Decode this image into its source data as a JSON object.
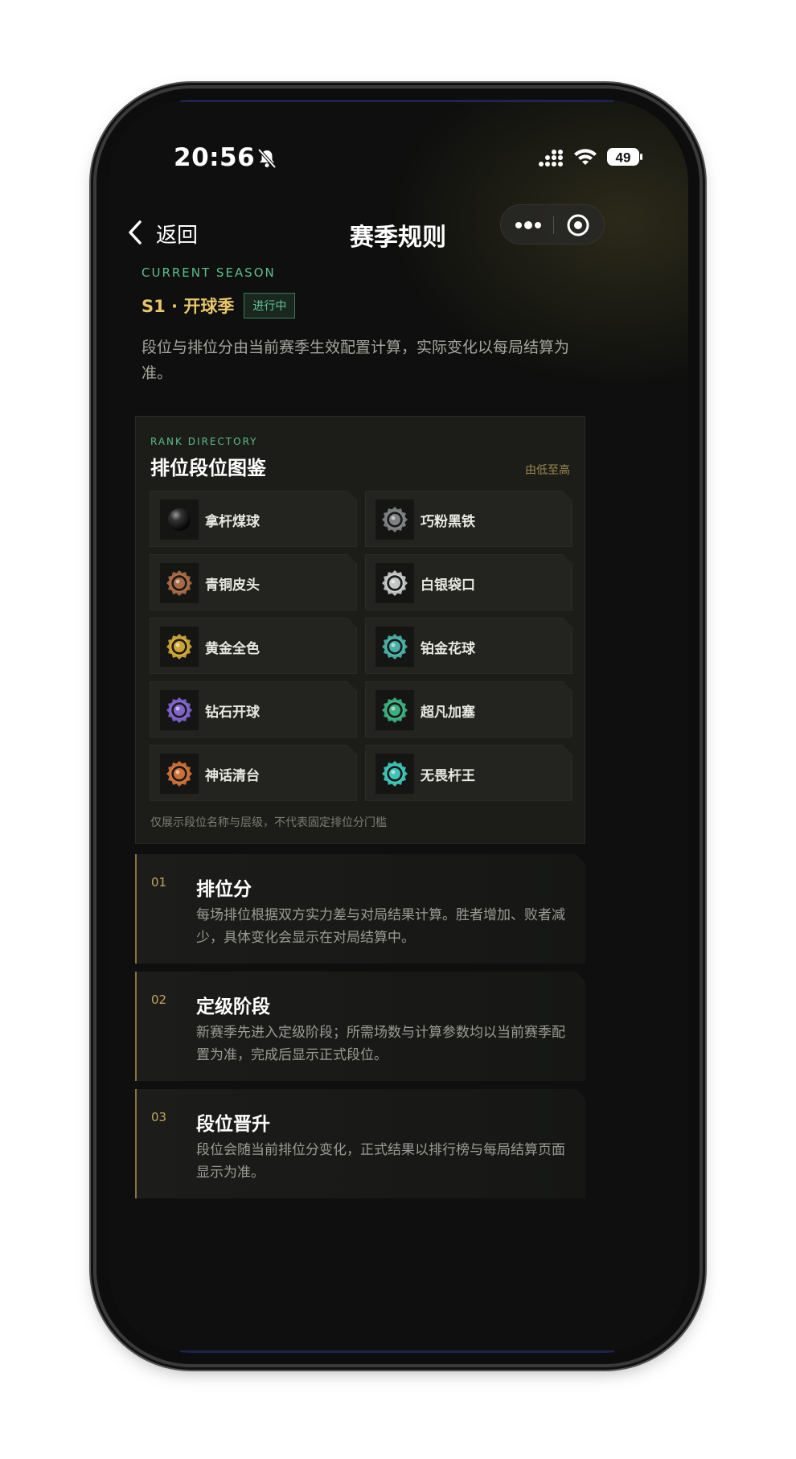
{
  "status_bar": {
    "time": "20:56",
    "battery": "49"
  },
  "nav": {
    "back_label": "返回",
    "title": "赛季规则"
  },
  "season": {
    "kicker": "CURRENT SEASON",
    "name": "S1 · 开球季",
    "badge": "进行中",
    "description": "段位与排位分由当前赛季生效配置计算，实际变化以每局结算为准。"
  },
  "rank_directory": {
    "kicker": "RANK DIRECTORY",
    "title": "排位段位图鉴",
    "sort_label": "由低至高",
    "ranks": [
      {
        "label": "拿杆煤球",
        "color": "#2a2a2a"
      },
      {
        "label": "巧粉黑铁",
        "color": "#8a8d90"
      },
      {
        "label": "青铜皮头",
        "color": "#b8744a"
      },
      {
        "label": "白银袋口",
        "color": "#d6d8da"
      },
      {
        "label": "黄金全色",
        "color": "#e0b43a"
      },
      {
        "label": "铂金花球",
        "color": "#4fc1b6"
      },
      {
        "label": "钻石开球",
        "color": "#8c6be0"
      },
      {
        "label": "超凡加塞",
        "color": "#3fbf8e"
      },
      {
        "label": "神话清台",
        "color": "#e07a3c"
      },
      {
        "label": "无畏杆王",
        "color": "#43d6c8"
      }
    ],
    "note": "仅展示段位名称与层级，不代表固定排位分门槛"
  },
  "rules": [
    {
      "number": "01",
      "title": "排位分",
      "description": "每场排位根据双方实力差与对局结果计算。胜者增加、败者减少，具体变化会显示在对局结算中。"
    },
    {
      "number": "02",
      "title": "定级阶段",
      "description": "新赛季先进入定级阶段；所需场数与计算参数均以当前赛季配置为准，完成后显示正式段位。"
    },
    {
      "number": "03",
      "title": "段位晋升",
      "description": "段位会随当前排位分变化，正式结果以排行榜与每局结算页面显示为准。"
    }
  ]
}
